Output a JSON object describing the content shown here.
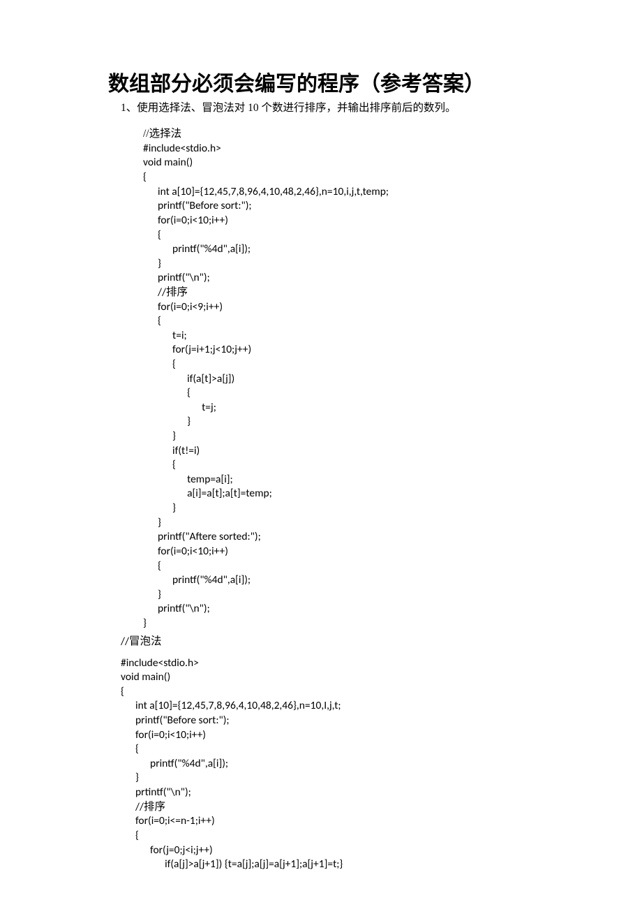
{
  "title": "数组部分必须会编写的程序（参考答案）",
  "subtitle": "1、使用选择法、冒泡法对 10 个数进行排序，并输出排序前后的数列。",
  "code1": {
    "l1": "//选择法",
    "l2": "#include<stdio.h>",
    "l3": "void main()",
    "l4": "{",
    "l5": "      int a[10]={12,45,7,8,96,4,10,48,2,46},n=10,i,j,t,temp;",
    "l6": "      printf(\"Before sort:\");",
    "l7": "      for(i=0;i<10;i++)",
    "l8": "      {",
    "l9": "            printf(\"%4d\",a[i]);",
    "l10": "      }",
    "l11": "      printf(\"\\n\");",
    "l12a": "      //",
    "l12b": "排序",
    "l13": "      for(i=0;i<9;i++)",
    "l14": "      {",
    "l15": "            t=i;",
    "l16": "            for(j=i+1;j<10;j++)",
    "l17": "            {",
    "l18": "                  if(a[t]>a[j])",
    "l19": "                  {",
    "l20": "                        t=j;",
    "l21": "                  }",
    "l22": "            }",
    "l23": "            if(t!=i)",
    "l24": "            {",
    "l25": "                  temp=a[i];",
    "l26": "                  a[i]=a[t];a[t]=temp;",
    "l27": "            }",
    "l28": "      }",
    "l29": "      printf(\"Aftere sorted:\");",
    "l30": "      for(i=0;i<10;i++)",
    "l31": "      {",
    "l32": "            printf(\"%4d\",a[i]);",
    "l33": "      }",
    "l34": "      printf(\"\\n\");",
    "l35": "}"
  },
  "comment2a": "//",
  "comment2b": "冒泡法",
  "code2": {
    "l1": "#include<stdio.h>",
    "l2": "void main()",
    "l3": "{",
    "l4": "      int a[10]={12,45,7,8,96,4,10,48,2,46},n=10,I,j,t;",
    "l5": "      printf(\"Before sort:\");",
    "l6": "      for(i=0;i<10;i++)",
    "l7": "      {",
    "l8": "            printf(\"%4d\",a[i]);",
    "l9": "      }",
    "l10": "      prtintf(\"\\n\");",
    "l11a": "      //",
    "l11b": "排序",
    "l12": "      for(i=0;i<=n-1;i++)",
    "l13": "      {",
    "l14": "            for(j=0;j<i;j++)",
    "l15": "                  if(a[j]>a[j+1]) {t=a[j];a[j]=a[j+1];a[j+1]=t;}"
  }
}
